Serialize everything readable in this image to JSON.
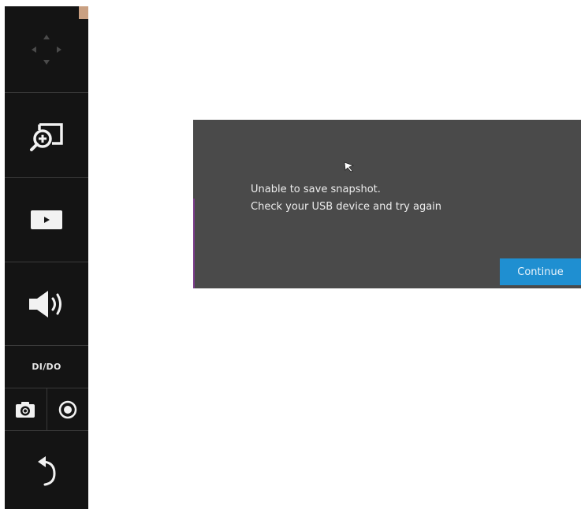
{
  "sidebar": {
    "tools": [
      {
        "name": "ptz-control",
        "icon": "dpad-arrows-icon"
      },
      {
        "name": "zoom",
        "icon": "zoom-in-window-icon"
      },
      {
        "name": "play",
        "icon": "play-icon"
      },
      {
        "name": "audio",
        "icon": "speaker-icon"
      },
      {
        "name": "dido",
        "label": "DI/DO"
      },
      {
        "name": "snapshot",
        "icon": "camera-icon"
      },
      {
        "name": "record",
        "icon": "record-icon"
      },
      {
        "name": "back",
        "icon": "back-arrow-icon"
      }
    ],
    "dido_label": "DI/DO"
  },
  "dialog": {
    "message_line1": "Unable to save snapshot.",
    "message_line2": "Check your USB device and try again",
    "continue_label": "Continue"
  },
  "colors": {
    "sidebar_bg": "#141414",
    "dialog_bg": "#4a4a4a",
    "accent_blue": "#1f8fd1",
    "page_bg": "#ffffff"
  }
}
